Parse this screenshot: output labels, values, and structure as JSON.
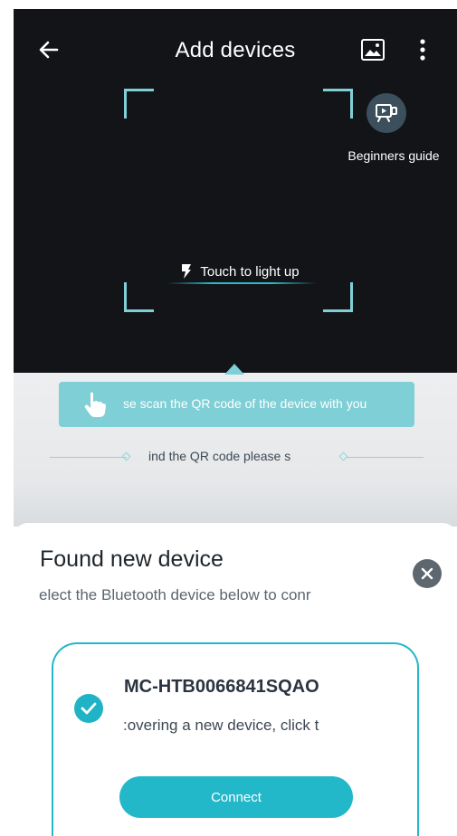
{
  "header": {
    "title": "Add devices",
    "back_icon": "arrow-left-icon",
    "gallery_icon": "image-icon",
    "more_icon": "more-vertical-icon"
  },
  "scanner": {
    "guide_label": "Beginners guide",
    "guide_icon": "video-guide-icon",
    "light_label": "Touch to light up",
    "light_icon": "flashlight-icon"
  },
  "instructions": {
    "tooltip_text": "se scan the QR code of the device with you",
    "hint_text": "ind the QR code please s",
    "tooltip_icon": "hand-pointer-icon"
  },
  "found_sheet": {
    "title": "Found new device",
    "subtitle": "elect the Bluetooth device below to conr",
    "close_icon": "close-icon",
    "device": {
      "name": "MC-HTB0066841SQAO",
      "status": ":overing a new device, click t",
      "selected": true,
      "check_icon": "check-circle-icon"
    },
    "connect_label": "Connect"
  },
  "colors": {
    "accent": "#22b8c9",
    "tooltip": "#7fcfd6",
    "camera_bg": "#121417",
    "frame_corner": "#7fd0d6"
  }
}
